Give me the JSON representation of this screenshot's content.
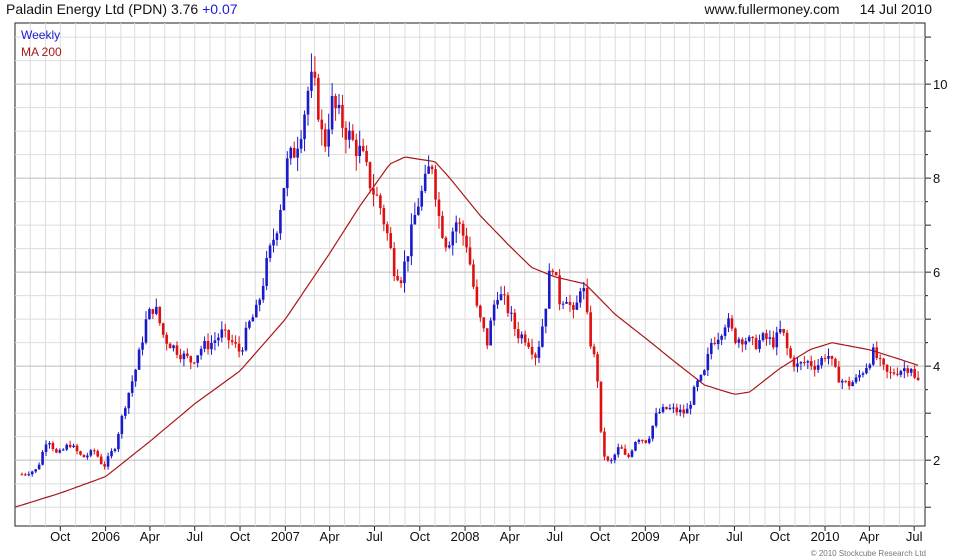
{
  "header": {
    "title": "Paladin Energy Ltd (PDN) 3.76",
    "change": "+0.07",
    "site": "www.fullermoney.com",
    "date": "14 Jul 2010"
  },
  "copyright": "© 2010 Stockcube Research Ltd",
  "colors": {
    "up": "#1a1acc",
    "down": "#dd1111",
    "ma": "#a81818",
    "grid": "#dddddd"
  },
  "chart_data": {
    "type": "candlestick",
    "interval_label": "Weekly",
    "legend": [
      {
        "label": "Weekly",
        "color": "#1a1acc"
      },
      {
        "label": "MA 200",
        "color": "#a81818"
      }
    ],
    "xlabels": [
      "Oct",
      "2006",
      "Apr",
      "Jul",
      "Oct",
      "2007",
      "Apr",
      "Jul",
      "Oct",
      "2008",
      "Apr",
      "Jul",
      "Oct",
      "2009",
      "Apr",
      "Jul",
      "Oct",
      "2010",
      "Apr",
      "Jul"
    ],
    "yticks": [
      2,
      4,
      6,
      8,
      10
    ],
    "ylim": [
      0.6,
      11.3
    ],
    "grid": true,
    "price_keypoints": [
      [
        "2005-07-15",
        1.7
      ],
      [
        "2005-08-15",
        1.8
      ],
      [
        "2005-09-05",
        2.5
      ],
      [
        "2005-09-25",
        2.1
      ],
      [
        "2005-10-20",
        2.35
      ],
      [
        "2005-11-15",
        2.05
      ],
      [
        "2005-12-10",
        2.2
      ],
      [
        "2005-12-28",
        1.85
      ],
      [
        "2006-01-20",
        2.3
      ],
      [
        "2006-02-10",
        3.2
      ],
      [
        "2006-03-05",
        4.0
      ],
      [
        "2006-03-25",
        5.0
      ],
      [
        "2006-04-10",
        5.3
      ],
      [
        "2006-04-30",
        4.6
      ],
      [
        "2006-05-20",
        4.4
      ],
      [
        "2006-06-10",
        4.2
      ],
      [
        "2006-06-25",
        4.1
      ],
      [
        "2006-07-15",
        4.4
      ],
      [
        "2006-08-05",
        4.5
      ],
      [
        "2006-08-25",
        4.7
      ],
      [
        "2006-09-15",
        4.5
      ],
      [
        "2006-10-01",
        4.3
      ],
      [
        "2006-10-20",
        4.9
      ],
      [
        "2006-11-05",
        5.2
      ],
      [
        "2006-11-25",
        6.2
      ],
      [
        "2006-12-15",
        7.0
      ],
      [
        "2007-01-05",
        8.3
      ],
      [
        "2007-01-20",
        8.6
      ],
      [
        "2007-02-05",
        9.2
      ],
      [
        "2007-02-20",
        10.1
      ],
      [
        "2007-03-05",
        9.8
      ],
      [
        "2007-03-20",
        8.6
      ],
      [
        "2007-04-05",
        9.6
      ],
      [
        "2007-04-25",
        9.2
      ],
      [
        "2007-05-15",
        8.8
      ],
      [
        "2007-06-05",
        8.5
      ],
      [
        "2007-06-25",
        7.8
      ],
      [
        "2007-07-10",
        7.5
      ],
      [
        "2007-07-25",
        6.9
      ],
      [
        "2007-08-10",
        6.1
      ],
      [
        "2007-08-25",
        5.9
      ],
      [
        "2007-09-10",
        6.6
      ],
      [
        "2007-09-25",
        7.4
      ],
      [
        "2007-10-10",
        7.8
      ],
      [
        "2007-10-25",
        8.4
      ],
      [
        "2007-11-10",
        7.1
      ],
      [
        "2007-11-25",
        6.6
      ],
      [
        "2007-12-15",
        7.1
      ],
      [
        "2008-01-05",
        6.6
      ],
      [
        "2008-01-25",
        5.2
      ],
      [
        "2008-02-15",
        4.5
      ],
      [
        "2008-03-05",
        5.6
      ],
      [
        "2008-03-25",
        5.3
      ],
      [
        "2008-04-15",
        4.7
      ],
      [
        "2008-05-05",
        4.6
      ],
      [
        "2008-05-25",
        4.2
      ],
      [
        "2008-06-10",
        5.1
      ],
      [
        "2008-06-25",
        6.3
      ],
      [
        "2008-07-10",
        5.4
      ],
      [
        "2008-07-25",
        5.5
      ],
      [
        "2008-08-10",
        5.0
      ],
      [
        "2008-08-25",
        5.9
      ],
      [
        "2008-09-10",
        4.6
      ],
      [
        "2008-09-25",
        3.9
      ],
      [
        "2008-10-05",
        2.2
      ],
      [
        "2008-10-20",
        1.9
      ],
      [
        "2008-11-10",
        2.3
      ],
      [
        "2008-11-25",
        2.0
      ],
      [
        "2008-12-15",
        2.5
      ],
      [
        "2009-01-05",
        2.4
      ],
      [
        "2009-01-25",
        3.0
      ],
      [
        "2009-02-15",
        3.1
      ],
      [
        "2009-03-05",
        3.05
      ],
      [
        "2009-03-25",
        3.0
      ],
      [
        "2009-04-15",
        3.6
      ],
      [
        "2009-04-30",
        3.8
      ],
      [
        "2009-05-15",
        4.5
      ],
      [
        "2009-06-01",
        4.7
      ],
      [
        "2009-06-15",
        5.0
      ],
      [
        "2009-07-01",
        4.6
      ],
      [
        "2009-07-20",
        4.6
      ],
      [
        "2009-08-10",
        4.45
      ],
      [
        "2009-08-30",
        4.6
      ],
      [
        "2009-09-20",
        4.5
      ],
      [
        "2009-10-05",
        4.8
      ],
      [
        "2009-10-20",
        4.2
      ],
      [
        "2009-11-05",
        4.0
      ],
      [
        "2009-11-25",
        4.1
      ],
      [
        "2009-12-15",
        4.0
      ],
      [
        "2010-01-05",
        4.3
      ],
      [
        "2010-01-25",
        3.8
      ],
      [
        "2010-02-15",
        3.6
      ],
      [
        "2010-03-05",
        3.7
      ],
      [
        "2010-03-25",
        4.0
      ],
      [
        "2010-04-10",
        4.3
      ],
      [
        "2010-04-25",
        4.0
      ],
      [
        "2010-05-10",
        3.8
      ],
      [
        "2010-05-25",
        3.9
      ],
      [
        "2010-06-10",
        3.95
      ],
      [
        "2010-06-25",
        4.0
      ],
      [
        "2010-07-05",
        3.6
      ],
      [
        "2010-07-14",
        3.76
      ]
    ],
    "ma200_keypoints": [
      [
        "2005-07-01",
        1.0
      ],
      [
        "2005-10-01",
        1.3
      ],
      [
        "2006-01-01",
        1.65
      ],
      [
        "2006-04-01",
        2.4
      ],
      [
        "2006-07-01",
        3.2
      ],
      [
        "2006-10-01",
        3.9
      ],
      [
        "2007-01-01",
        5.0
      ],
      [
        "2007-04-01",
        6.4
      ],
      [
        "2007-06-01",
        7.4
      ],
      [
        "2007-08-01",
        8.3
      ],
      [
        "2007-09-01",
        8.45
      ],
      [
        "2007-11-01",
        8.35
      ],
      [
        "2007-12-01",
        8.0
      ],
      [
        "2008-02-01",
        7.2
      ],
      [
        "2008-04-01",
        6.55
      ],
      [
        "2008-05-15",
        6.1
      ],
      [
        "2008-07-01",
        5.9
      ],
      [
        "2008-09-01",
        5.75
      ],
      [
        "2008-11-01",
        5.1
      ],
      [
        "2009-01-01",
        4.6
      ],
      [
        "2009-03-01",
        4.1
      ],
      [
        "2009-05-01",
        3.6
      ],
      [
        "2009-07-01",
        3.4
      ],
      [
        "2009-08-01",
        3.45
      ],
      [
        "2009-10-01",
        3.95
      ],
      [
        "2009-12-01",
        4.35
      ],
      [
        "2010-01-15",
        4.5
      ],
      [
        "2010-04-01",
        4.35
      ],
      [
        "2010-06-01",
        4.15
      ],
      [
        "2010-07-14",
        4.0
      ]
    ]
  }
}
